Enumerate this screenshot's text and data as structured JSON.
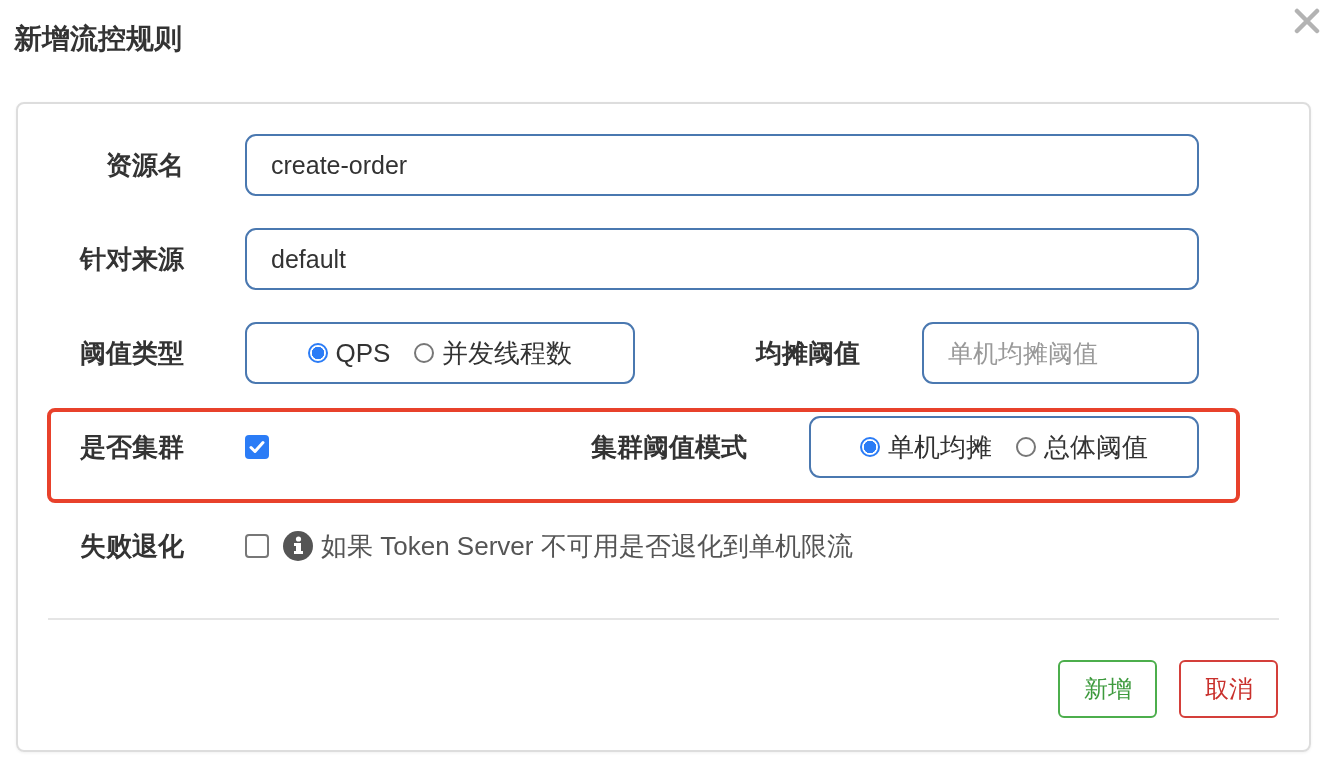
{
  "dialog": {
    "title": "新增流控规则"
  },
  "rows": [
    {
      "kind": "text",
      "label": "资源名",
      "value": "create-order"
    },
    {
      "kind": "text",
      "label": "针对来源",
      "value": "default"
    },
    {
      "kind": "radio",
      "label": "阈值类型",
      "options": [
        {
          "label": "QPS",
          "selected": true
        },
        {
          "label": "并发线程数",
          "selected": false
        }
      ],
      "side": {
        "kind": "input",
        "label": "均摊阈值",
        "placeholder": "单机均摊阈值"
      }
    },
    {
      "kind": "checkbox",
      "label": "是否集群",
      "checked": true,
      "side": {
        "kind": "radio",
        "label": "集群阈值模式",
        "options": [
          {
            "label": "单机均摊",
            "selected": true
          },
          {
            "label": "总体阈值",
            "selected": false
          }
        ]
      },
      "highlighted": true
    },
    {
      "kind": "checkbox",
      "label": "失败退化",
      "checked": false,
      "hint": "如果 Token Server 不可用是否退化到单机限流"
    }
  ],
  "buttons": [
    {
      "label": "新增",
      "kind": "success"
    },
    {
      "label": "取消",
      "kind": "danger"
    }
  ]
}
